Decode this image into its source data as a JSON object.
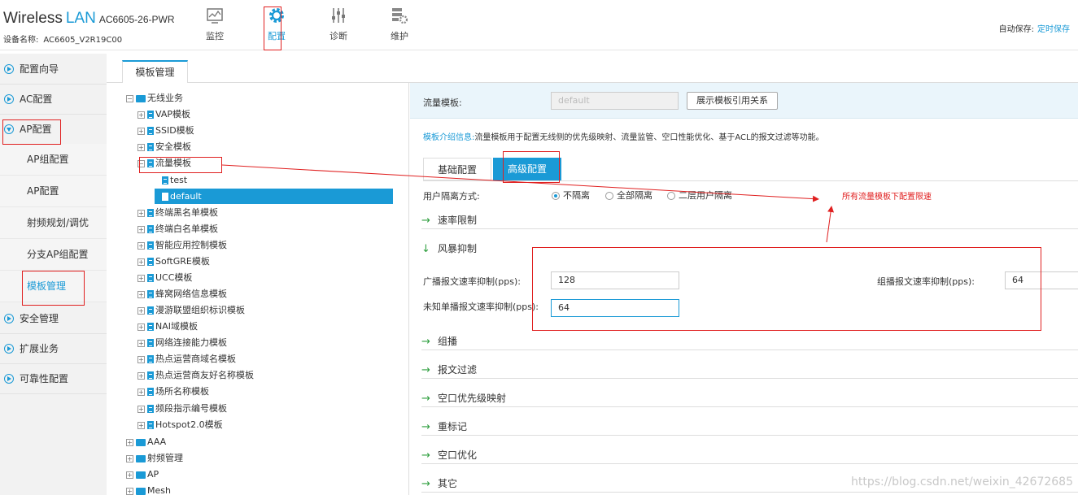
{
  "header": {
    "brand_wireless": "Wireless",
    "brand_lan": "LAN",
    "model": "AC6605-26-PWR",
    "device_label": "设备名称:",
    "device_value": "AC6605_V2R19C00",
    "nav": [
      {
        "label": "监控",
        "icon": "monitor-icon"
      },
      {
        "label": "配置",
        "icon": "gear-icon"
      },
      {
        "label": "诊断",
        "icon": "sliders-icon"
      },
      {
        "label": "维护",
        "icon": "maintenance-icon"
      }
    ],
    "autosave_label": "自动保存:",
    "autosave_link": "定时保存"
  },
  "sidebar": {
    "items": [
      {
        "label": "配置向导"
      },
      {
        "label": "AC配置"
      },
      {
        "label": "AP配置"
      },
      {
        "label": "安全管理"
      },
      {
        "label": "扩展业务"
      },
      {
        "label": "可靠性配置"
      }
    ],
    "subitems": [
      {
        "label": "AP组配置"
      },
      {
        "label": "AP配置"
      },
      {
        "label": "射频规划/调优"
      },
      {
        "label": "分支AP组配置"
      },
      {
        "label": "模板管理"
      }
    ]
  },
  "tab": {
    "label": "模板管理"
  },
  "tree": {
    "root": "无线业务",
    "children": [
      "VAP模板",
      "SSID模板",
      "安全模板",
      "流量模板",
      "终端黑名单模板",
      "终端白名单模板",
      "智能应用控制模板",
      "SoftGRE模板",
      "UCC模板",
      "蜂窝网络信息模板",
      "漫游联盟组织标识模板",
      "NAI域模板",
      "网络连接能力模板",
      "热点运营商域名模板",
      "热点运营商友好名称模板",
      "场所名称模板",
      "频段指示编号模板",
      "Hotspot2.0模板"
    ],
    "leaves": [
      "test",
      "default"
    ],
    "top_level": [
      "AAA",
      "射频管理",
      "AP",
      "Mesh"
    ]
  },
  "panel": {
    "template_label": "流量模板:",
    "template_value": "default",
    "show_relation_button": "展示模板引用关系",
    "desc_key": "模板介绍信息:",
    "desc_text": "流量模板用于配置无线侧的优先级映射、流量监管、空口性能优化、基于ACL的报文过滤等功能。",
    "tab_basic": "基础配置",
    "tab_advanced": "高级配置",
    "isolation_label": "用户隔离方式:",
    "isolation_options": [
      "不隔离",
      "全部隔离",
      "二层用户隔离"
    ],
    "note": "所有流量模板下配置限速",
    "sections": [
      "速率限制",
      "风暴抑制",
      "组播",
      "报文过滤",
      "空口优先级映射",
      "重标记",
      "空口优化",
      "其它"
    ],
    "broadcast_label": "广播报文速率抑制(pps):",
    "broadcast_value": "128",
    "multicast_label": "组播报文速率抑制(pps):",
    "multicast_value": "64",
    "unknown_unicast_label": "未知单播报文速率抑制(pps):",
    "unknown_unicast_value": "64"
  },
  "watermark": "https://blog.csdn.net/weixin_42672685",
  "colors": {
    "accent": "#1a9ad6",
    "annotation": "#e02020",
    "section_arrow": "#2e9e3e"
  }
}
